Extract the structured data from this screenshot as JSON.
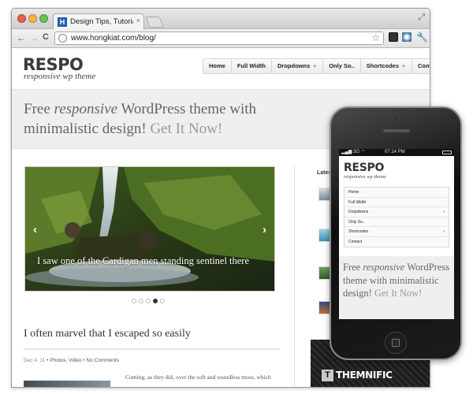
{
  "browser": {
    "tab_title": "Design Tips, Tutorials and In",
    "tab_favicon": "H",
    "tab_close": "×",
    "url": "www.hongkiat.com/blog/",
    "nav": {
      "back": "←",
      "forward": "→",
      "reload": "C"
    },
    "icons": [
      "bookmark-star-icon",
      "extension-icon",
      "extension-icon",
      "wrench-icon"
    ]
  },
  "site": {
    "logo": "RESPO",
    "tagline": "responsive wp theme",
    "menu": [
      {
        "label": "Home",
        "has_dropdown": false
      },
      {
        "label": "Full Width",
        "has_dropdown": false
      },
      {
        "label": "Dropdowns",
        "has_dropdown": true
      },
      {
        "label": "Only So..",
        "has_dropdown": false
      },
      {
        "label": "Shortcodes",
        "has_dropdown": true
      },
      {
        "label": "Contact",
        "has_dropdown": false
      }
    ],
    "hero": {
      "lead": "Free ",
      "emph": "responsive",
      "rest": " WordPress theme with minimalistic design! ",
      "cta": "Get It Now!"
    },
    "slider": {
      "caption": "I saw one of the Cardigan men standing sentinel there",
      "prev": "‹",
      "next": "›",
      "dot_count": 5,
      "active_dot": 3
    },
    "post": {
      "title": "I often marvel that I escaped so easily",
      "date": "Dec 4, 11",
      "categories": "Photos, Video",
      "comments": "No Comments",
      "excerpt": "Coming, as they did, over the soft and soundless moss, which"
    },
    "sidebar": {
      "title": "Latest"
    },
    "banner": {
      "mark": "T",
      "text": "THEMNIFIC"
    }
  },
  "phone": {
    "carrier": "3G",
    "time": "07:14 PM",
    "logo": "RESPO",
    "tagline": "responsive wp theme",
    "menu": [
      {
        "label": "Home",
        "has_dropdown": false
      },
      {
        "label": "Full Width",
        "has_dropdown": false
      },
      {
        "label": "Dropdowns",
        "has_dropdown": true
      },
      {
        "label": "Only So..",
        "has_dropdown": false
      },
      {
        "label": "Shortcodes",
        "has_dropdown": true
      },
      {
        "label": "Contact",
        "has_dropdown": false
      }
    ],
    "hero": {
      "lead": "Free ",
      "emph": "responsive",
      "rest": " WordPress theme with minimalistic design! ",
      "cta": "Get It Now!"
    }
  },
  "colors": {
    "hero_band": "#efefef",
    "hero_text": "#666666",
    "cta_text": "#9a9a9a",
    "banner_bg": "#1f1f1f"
  }
}
